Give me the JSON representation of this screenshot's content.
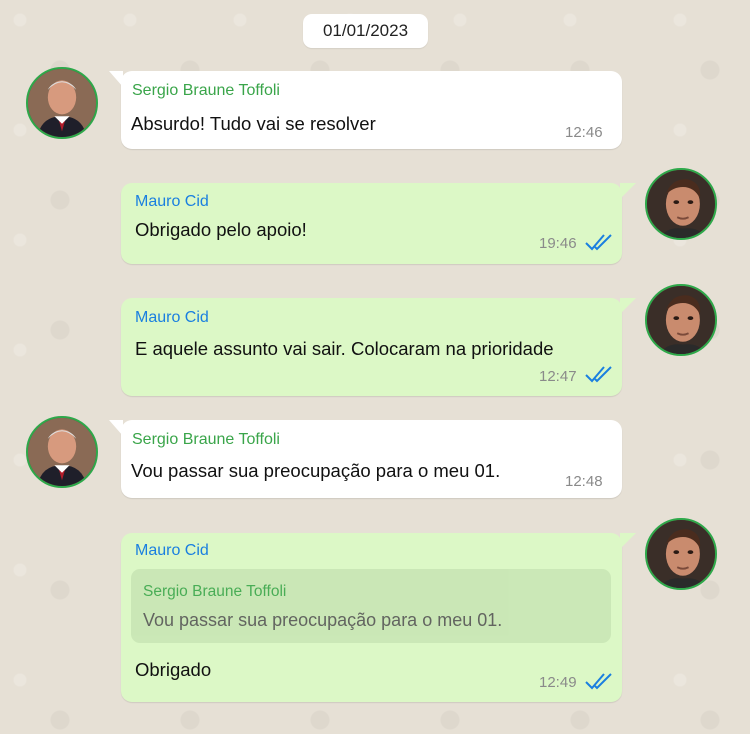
{
  "date_label": "01/01/2023",
  "contacts": {
    "toffoli": "Sergio Braune Toffoli",
    "cid": "Mauro Cid"
  },
  "messages": [
    {
      "sender": "Sergio Braune Toffoli",
      "text": "Absurdo! Tudo vai se resolver",
      "time": "12:46",
      "direction": "incoming"
    },
    {
      "sender": "Mauro Cid",
      "text": "Obrigado pelo apoio!",
      "time": "19:46",
      "direction": "outgoing",
      "status": "read"
    },
    {
      "sender": "Mauro Cid",
      "text": "E aquele assunto vai sair. Colocaram na prioridade",
      "time": "12:47",
      "direction": "outgoing",
      "status": "read"
    },
    {
      "sender": "Sergio Braune Toffoli",
      "text": "Vou passar sua preocupação para o meu 01.",
      "time": "12:48",
      "direction": "incoming"
    },
    {
      "sender": "Mauro Cid",
      "text": "Obrigado",
      "time": "12:49",
      "direction": "outgoing",
      "status": "read",
      "quoted": {
        "sender": "Sergio Braune Toffoli",
        "text": "Vou passar sua preocupação para o meu 01."
      }
    }
  ],
  "colors": {
    "background": "#e6e0d5",
    "incoming_bubble": "#ffffff",
    "outgoing_bubble": "#dcf8c6",
    "incoming_name": "#3aa54a",
    "outgoing_name": "#1a7fe0",
    "read_ticks": "#1a7fe0",
    "avatar_ring": "#2ea84a"
  },
  "icons": {
    "read_status": "double-check-icon"
  }
}
